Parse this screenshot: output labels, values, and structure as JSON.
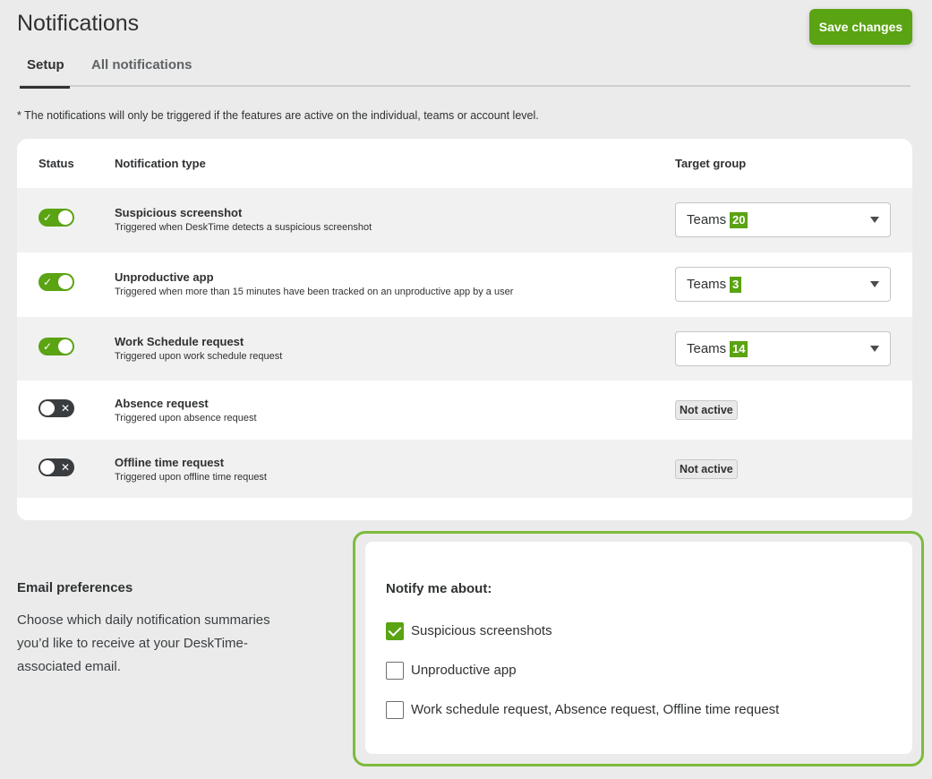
{
  "header": {
    "title": "Notifications",
    "save_label": "Save changes"
  },
  "tabs": [
    {
      "label": "Setup",
      "active": true
    },
    {
      "label": "All notifications",
      "active": false
    }
  ],
  "note": "* The notifications will only be triggered if the features are active on the individual, teams or account level.",
  "table": {
    "columns": [
      "Status",
      "Notification type",
      "Target group"
    ],
    "rows": [
      {
        "enabled": true,
        "title": "Suspicious screenshot",
        "description": "Triggered when DeskTime detects a suspicious screenshot",
        "target_label": "Teams",
        "target_count": "20"
      },
      {
        "enabled": true,
        "title": "Unproductive app",
        "description": "Triggered when more than 15 minutes have been tracked on an unproductive app by a user",
        "target_label": "Teams",
        "target_count": "3"
      },
      {
        "enabled": true,
        "title": "Work Schedule request",
        "description": "Triggered upon work schedule request",
        "target_label": "Teams",
        "target_count": "14"
      },
      {
        "enabled": false,
        "title": "Absence request",
        "description": "Triggered upon absence request",
        "status_badge": "Not active"
      },
      {
        "enabled": false,
        "title": "Offline time request",
        "description": "Triggered upon offline time request",
        "status_badge": "Not active"
      }
    ]
  },
  "email": {
    "title": "Email preferences",
    "description": "Choose which daily notification summaries you’d like to receive at your DeskTime-associated email."
  },
  "notify": {
    "title": "Notify me about:",
    "options": [
      {
        "label": "Suspicious screenshots",
        "checked": true
      },
      {
        "label": "Unproductive app",
        "checked": false
      },
      {
        "label": "Work schedule request, Absence request, Offline time request",
        "checked": false
      }
    ]
  },
  "colors": {
    "accent": "#5aa312",
    "highlight_border": "#7cbb3c",
    "background": "#ebebeb"
  }
}
